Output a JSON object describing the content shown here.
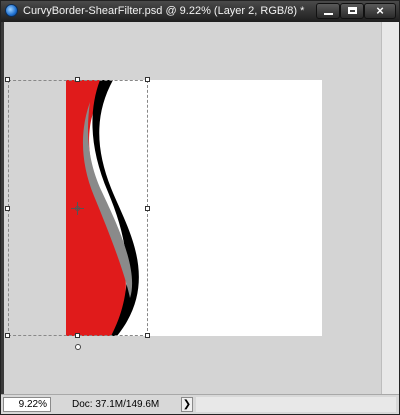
{
  "window": {
    "title": "CurvyBorder-ShearFilter.psd @ 9.22% (Layer 2, RGB/8) *",
    "minimize_icon": "minimize-icon",
    "maximize_icon": "maximize-icon",
    "close_label": "×",
    "close_icon": "close-icon"
  },
  "canvas": {
    "background_color": "#d4d4d4",
    "document_color": "#ffffff",
    "shape_colors": {
      "red": "#e01b1b",
      "gray": "#8a8a8a",
      "black": "#000000"
    },
    "transform_center_icon": "crosshair-icon"
  },
  "status": {
    "zoom": "9.22%",
    "doc_info": "Doc: 37.1M/149.6M",
    "menu_arrow": "❯"
  }
}
